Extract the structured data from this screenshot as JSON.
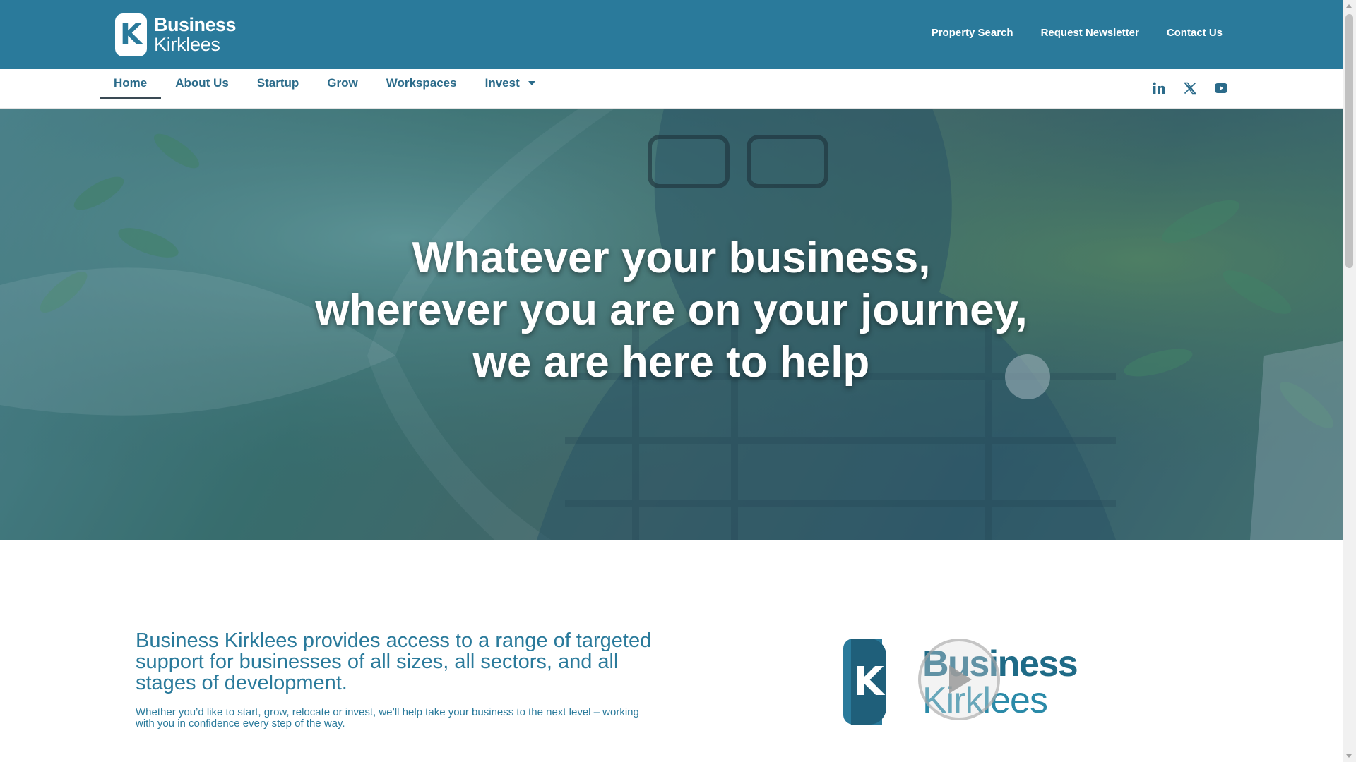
{
  "brand": {
    "logo_line1": "Business",
    "logo_line2": "Kirklees",
    "logo_letter": "K",
    "primary_color": "#2a7a9b",
    "dark_color": "#1f5f7a"
  },
  "utility_nav": [
    {
      "label": "Property Search"
    },
    {
      "label": "Request Newsletter"
    },
    {
      "label": "Contact Us"
    }
  ],
  "main_nav": [
    {
      "label": "Home",
      "active": true
    },
    {
      "label": "About Us"
    },
    {
      "label": "Startup"
    },
    {
      "label": "Grow"
    },
    {
      "label": "Workspaces"
    },
    {
      "label": "Invest",
      "has_dropdown": true
    }
  ],
  "social": [
    {
      "icon": "linkedin-icon"
    },
    {
      "icon": "x-twitter-icon"
    },
    {
      "icon": "youtube-icon"
    }
  ],
  "hero": {
    "line1": "Whatever your business,",
    "line2": "wherever you are on your journey,",
    "line3": "we are here to help"
  },
  "intro": {
    "lead": "Business Kirklees provides access to a range of targeted support for businesses of all sizes, all sectors, and all stages of development.",
    "sub": "Whether you’d like to start, grow, relocate or invest, we’ll help take your business to the next level – working with you in confidence every step of the way."
  },
  "video": {
    "logo_line1": "Business",
    "logo_line2": "Kirklees",
    "logo_letter": "K",
    "icon": "play-icon"
  }
}
